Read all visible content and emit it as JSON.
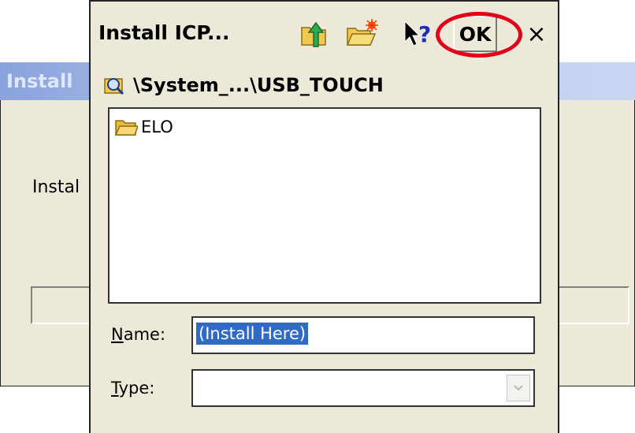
{
  "background_window": {
    "title": "Install",
    "label": "Instal"
  },
  "dialog": {
    "title": "Install ICP...",
    "toolbar": {
      "up_icon": "up-folder-icon",
      "new_folder_icon": "new-folder-icon",
      "help_icon": "whats-this-help-icon",
      "ok_label": "OK",
      "close_label": "×"
    },
    "path": "\\System_...\\USB_TOUCH",
    "files": [
      {
        "name": "ELO",
        "icon": "folder-icon"
      }
    ],
    "name_field": {
      "label_accel": "N",
      "label_rest": "ame:",
      "value": "(Install Here)"
    },
    "type_field": {
      "label_accel": "T",
      "label_rest": "ype:",
      "value": ""
    }
  },
  "colors": {
    "highlight_circle": "#e3001b",
    "selection": "#316ac5",
    "dialog_bg": "#ece9d8"
  }
}
